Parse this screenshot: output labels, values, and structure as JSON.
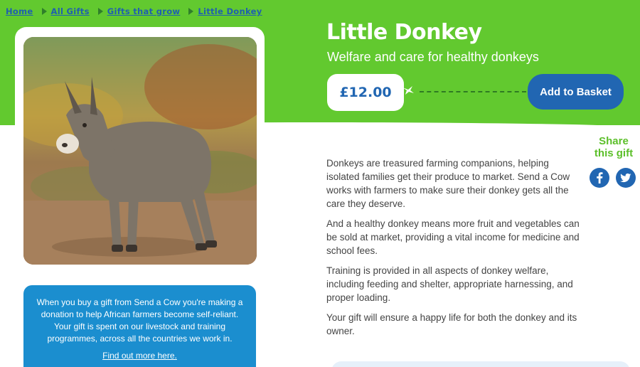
{
  "breadcrumb": {
    "items": [
      "Home",
      "All Gifts",
      "Gifts that grow",
      "Little Donkey"
    ]
  },
  "product": {
    "title": "Little Donkey",
    "subtitle": "Welfare and care for healthy donkeys",
    "price": "£12.00",
    "add_to_basket": "Add to Basket",
    "description": [
      "Donkeys are treasured farming companions, helping isolated families get their produce to market. Send a Cow works with farmers to make sure their donkey gets all the care they deserve.",
      "And a healthy donkey means more fruit and vegetables can be sold at market, providing a vital income for medicine and school fees.",
      "Training is provided in all aspects of donkey welfare, including feeding and shelter, appropriate harnessing, and proper loading.",
      "Your gift will ensure a happy life for both the donkey and its owner."
    ]
  },
  "share": {
    "label_line1": "Share",
    "label_line2": "this gift",
    "icons": [
      "facebook-icon",
      "twitter-icon"
    ]
  },
  "info_box": {
    "text": "When you buy a gift from Send a Cow you're making a donation to help African farmers become self-reliant. Your gift is spent on our livestock and training programmes, across all the countries we work in.",
    "link": "Find out more here."
  },
  "colors": {
    "brand_green": "#62c92f",
    "brand_blue": "#2166b2",
    "info_blue": "#1b8ecf"
  }
}
